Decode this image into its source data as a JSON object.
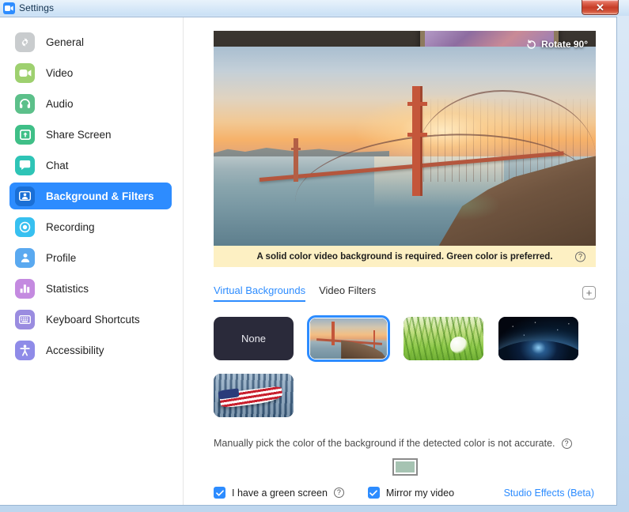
{
  "window": {
    "title": "Settings",
    "app_icon": "zoom-camera-icon",
    "close_label": "✕"
  },
  "sidebar": {
    "items": [
      {
        "label": "General",
        "icon": "gear-icon",
        "color": "#c9ccce",
        "active": false
      },
      {
        "label": "Video",
        "icon": "camera-icon",
        "color": "#9ed06f",
        "active": false
      },
      {
        "label": "Audio",
        "icon": "headphones-icon",
        "color": "#5cc08a",
        "active": false
      },
      {
        "label": "Share Screen",
        "icon": "share-screen-icon",
        "color": "#3fbf87",
        "active": false
      },
      {
        "label": "Chat",
        "icon": "chat-bubble-icon",
        "color": "#2ec4b6",
        "active": false
      },
      {
        "label": "Background & Filters",
        "icon": "person-card-icon",
        "color": "#2d8cff",
        "active": true
      },
      {
        "label": "Recording",
        "icon": "record-circle-icon",
        "color": "#37c0f0",
        "active": false
      },
      {
        "label": "Profile",
        "icon": "person-icon",
        "color": "#5aa9f0",
        "active": false
      },
      {
        "label": "Statistics",
        "icon": "bar-chart-icon",
        "color": "#c48ae0",
        "active": false
      },
      {
        "label": "Keyboard Shortcuts",
        "icon": "keyboard-icon",
        "color": "#9a8ce0",
        "active": false
      },
      {
        "label": "Accessibility",
        "icon": "accessibility-icon",
        "color": "#8f8be8",
        "active": false
      }
    ]
  },
  "preview": {
    "rotate_label": "Rotate 90°",
    "rotate_icon": "rotate-ccw-icon",
    "background_name": "Golden Gate Bridge"
  },
  "notice": {
    "text": "A solid color video background is required. Green color is preferred.",
    "help_icon": "question-mark-icon",
    "background_color": "#fdf0c3"
  },
  "tabs": {
    "items": [
      {
        "label": "Virtual Backgrounds",
        "active": true
      },
      {
        "label": "Video Filters",
        "active": false
      }
    ],
    "add_icon": "plus-icon",
    "add_label": "+"
  },
  "backgrounds": {
    "items": [
      {
        "label": "None",
        "art": "none",
        "selected": false
      },
      {
        "label": "Golden Gate Bridge",
        "art": "ggb",
        "selected": true
      },
      {
        "label": "Grass",
        "art": "grass",
        "selected": false
      },
      {
        "label": "Earth from Space",
        "art": "space",
        "selected": false
      },
      {
        "label": "American Flag",
        "art": "flag",
        "selected": false
      }
    ]
  },
  "manual_pick": {
    "text": "Manually pick the color of the background if the detected color is not accurate.",
    "help_icon": "question-mark-icon",
    "swatch_color": "#a6c3b2"
  },
  "options": {
    "green_screen": {
      "label": "I have a green screen",
      "checked": true,
      "help_icon": "question-mark-icon"
    },
    "mirror_video": {
      "label": "Mirror my video",
      "checked": true
    },
    "studio_effects_link": "Studio Effects (Beta)"
  },
  "colors": {
    "accent": "#2d8cff",
    "notice_bg": "#fdf0c3",
    "link": "#2d8cff",
    "text": "#1d1d1d"
  }
}
